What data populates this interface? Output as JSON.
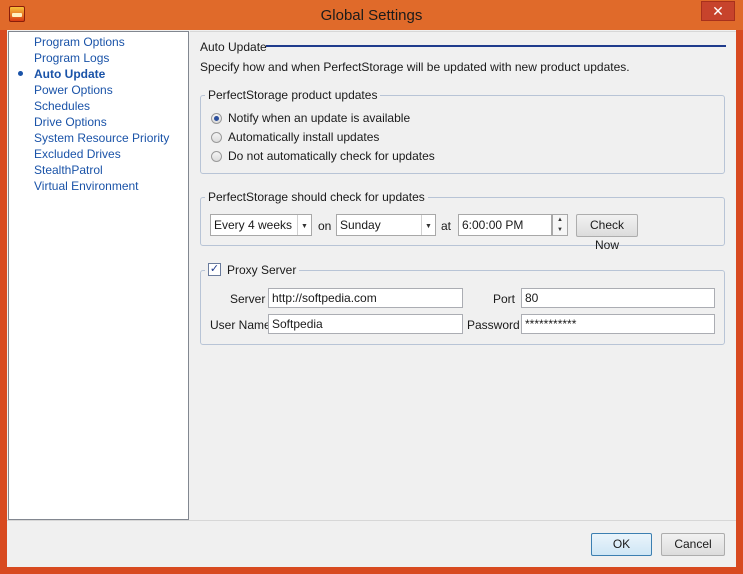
{
  "window": {
    "title": "Global Settings",
    "close_glyph": "✕"
  },
  "sidebar": {
    "items": [
      {
        "label": "Program Options"
      },
      {
        "label": "Program Logs"
      },
      {
        "label": "Auto Update",
        "selected": true
      },
      {
        "label": "Power Options"
      },
      {
        "label": "Schedules"
      },
      {
        "label": "Drive Options"
      },
      {
        "label": "System Resource Priority"
      },
      {
        "label": "Excluded Drives"
      },
      {
        "label": "StealthPatrol"
      },
      {
        "label": "Virtual Environment"
      }
    ]
  },
  "main": {
    "section_title": "Auto Update",
    "description": "Specify how and when PerfectStorage will be updated with new product updates.",
    "product_updates": {
      "label": "PerfectStorage product updates",
      "options": [
        {
          "label": "Notify when an update is available",
          "checked": true
        },
        {
          "label": "Automatically install updates",
          "checked": false
        },
        {
          "label": "Do not automatically check for updates",
          "checked": false
        }
      ]
    },
    "check_schedule": {
      "label": "PerfectStorage should check for updates",
      "frequency": "Every 4 weeks",
      "on_label": "on",
      "day": "Sunday",
      "at_label": "at",
      "time": "6:00:00 PM",
      "check_now_label": "Check Now"
    },
    "proxy": {
      "label": "Proxy Server",
      "enabled": true,
      "server_label": "Server",
      "server_value": "http://softpedia.com",
      "port_label": "Port",
      "port_value": "80",
      "username_label": "User Name",
      "username_value": "Softpedia",
      "password_label": "Password",
      "password_value": "***********"
    }
  },
  "footer": {
    "ok_label": "OK",
    "cancel_label": "Cancel"
  },
  "icons": {
    "dropdown": "▼",
    "spin_up": "▲",
    "spin_down": "▼",
    "checkmark": "✓"
  }
}
